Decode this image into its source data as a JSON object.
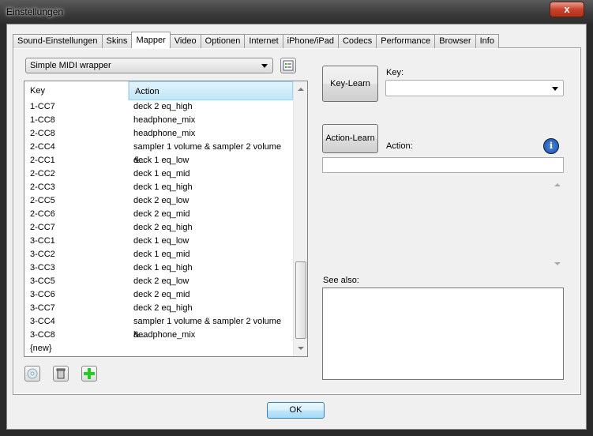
{
  "window": {
    "title": "Einstellungen",
    "close_label": "x"
  },
  "tabs": [
    {
      "label": "Sound-Einstellungen"
    },
    {
      "label": "Skins"
    },
    {
      "label": "Mapper",
      "active": true
    },
    {
      "label": "Video"
    },
    {
      "label": "Optionen"
    },
    {
      "label": "Internet"
    },
    {
      "label": "iPhone/iPad"
    },
    {
      "label": "Codecs"
    },
    {
      "label": "Performance"
    },
    {
      "label": "Browser"
    },
    {
      "label": "Info"
    }
  ],
  "mapper": {
    "selected": "Simple MIDI wrapper"
  },
  "table": {
    "columns": [
      "Key",
      "Action"
    ],
    "rows": [
      [
        "1-CC7",
        "deck 2 eq_high"
      ],
      [
        "1-CC8",
        "headphone_mix"
      ],
      [
        "2-CC8",
        "headphone_mix"
      ],
      [
        "2-CC4",
        "sampler 1 volume & sampler 2 volume &..."
      ],
      [
        "2-CC1",
        "deck 1 eq_low"
      ],
      [
        "2-CC2",
        "deck 1 eq_mid"
      ],
      [
        "2-CC3",
        "deck 1 eq_high"
      ],
      [
        "2-CC5",
        "deck 2 eq_low"
      ],
      [
        "2-CC6",
        "deck 2 eq_mid"
      ],
      [
        "2-CC7",
        "deck 2 eq_high"
      ],
      [
        "3-CC1",
        "deck 1 eq_low"
      ],
      [
        "3-CC2",
        "deck 1 eq_mid"
      ],
      [
        "3-CC3",
        "deck 1 eq_high"
      ],
      [
        "3-CC5",
        "deck 2 eq_low"
      ],
      [
        "3-CC6",
        "deck 2 eq_mid"
      ],
      [
        "3-CC7",
        "deck 2 eq_high"
      ],
      [
        "3-CC4",
        "sampler 1 volume & sampler 2 volume &..."
      ],
      [
        "3-CC8",
        "headphone_mix"
      ],
      [
        "{new}",
        ""
      ]
    ]
  },
  "right": {
    "key_learn": "Key-Learn",
    "key_label": "Key:",
    "key_value": "",
    "action_learn": "Action-Learn",
    "action_label": "Action:",
    "action_value": "",
    "see_also": "See also:"
  },
  "footer": {
    "ok": "OK"
  }
}
